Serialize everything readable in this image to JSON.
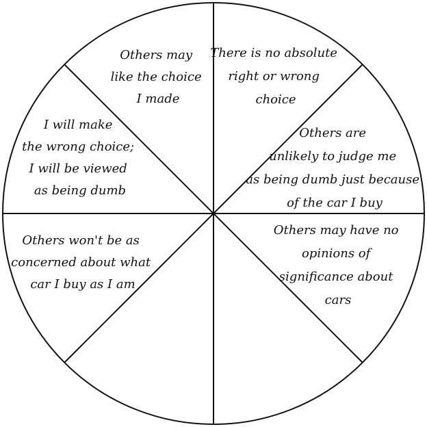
{
  "diagram": {
    "segments": [
      {
        "id": "seg-top-left",
        "lines": [
          "Others may",
          "like the choice",
          "I made"
        ]
      },
      {
        "id": "seg-top-right",
        "lines": [
          "There is no absolute",
          "right or wrong",
          "choice"
        ]
      },
      {
        "id": "seg-right-upper",
        "lines": [
          "Others are",
          "unlikely to judge me",
          "as being dumb just because",
          "of the car I buy"
        ]
      },
      {
        "id": "seg-right-lower",
        "lines": [
          "Others may have no",
          "opinions of",
          "significance about",
          "cars"
        ]
      },
      {
        "id": "seg-bottom-right",
        "lines": []
      },
      {
        "id": "seg-bottom-left",
        "lines": []
      },
      {
        "id": "seg-left-lower",
        "lines": [
          "Others won't be as",
          "concerned about what",
          "car I buy as I am"
        ]
      },
      {
        "id": "seg-left-upper",
        "lines": [
          "I will make",
          "the wrong choice;",
          "I will be viewed",
          "as being dumb"
        ]
      }
    ],
    "colors": {
      "stroke": "#111111",
      "fill": "#ffffff",
      "text": "#111111"
    }
  }
}
